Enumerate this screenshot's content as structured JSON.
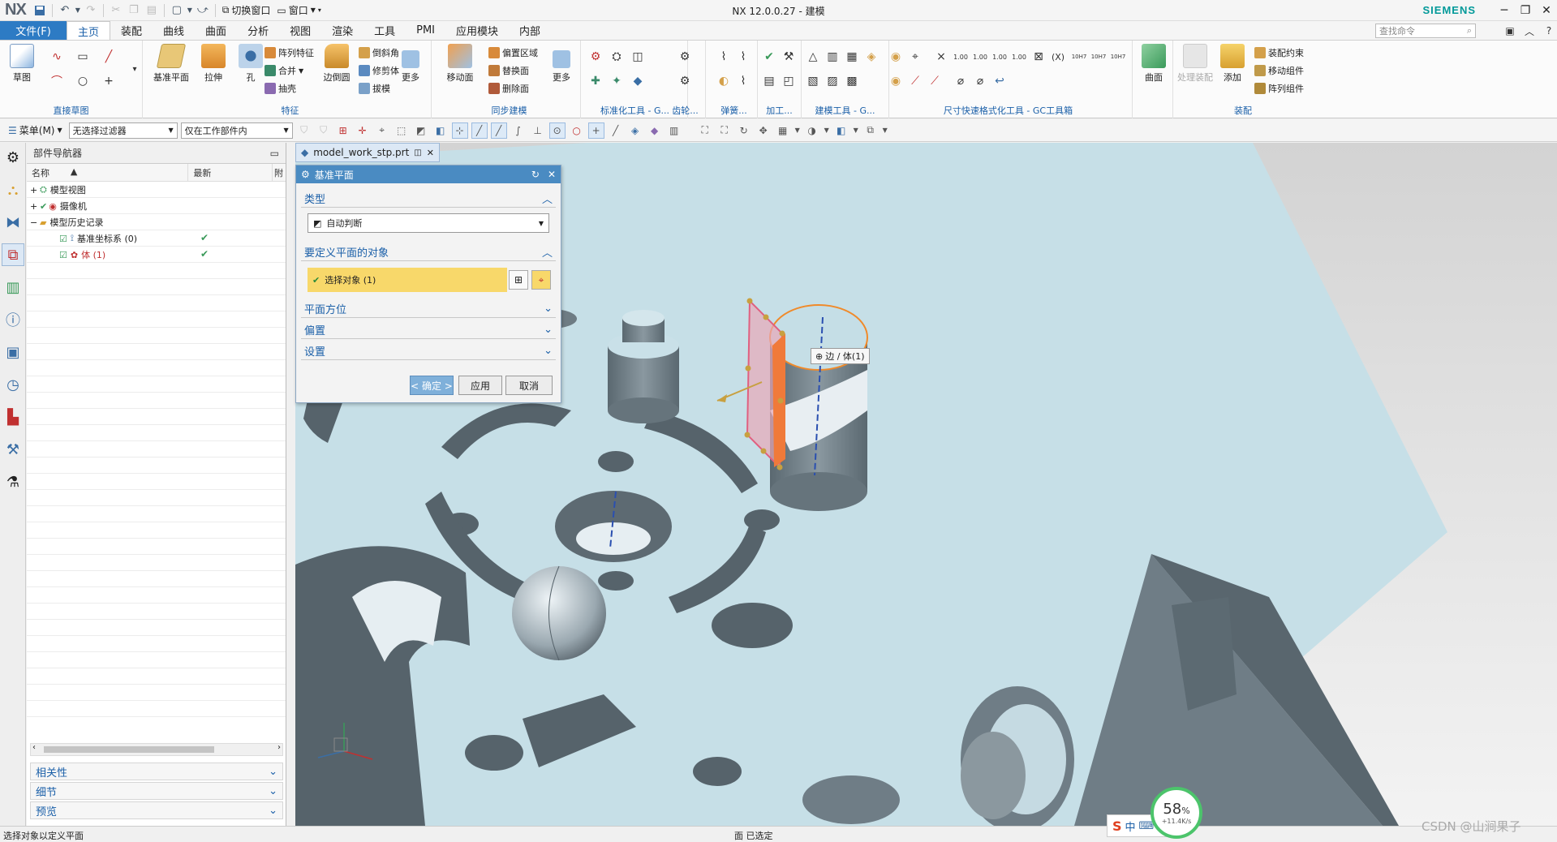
{
  "app": {
    "logo": "NX",
    "window_title": "NX 12.0.0.27 - 建模",
    "brand": "SIEMENS",
    "quick_access": {
      "switch_window": "切换窗口",
      "window": "窗口"
    }
  },
  "menu_tabs": {
    "file": "文件(F)",
    "items": [
      "主页",
      "装配",
      "曲线",
      "曲面",
      "分析",
      "视图",
      "渲染",
      "工具",
      "PMI",
      "应用模块",
      "内部"
    ],
    "active": "主页",
    "search_placeholder": "查找命令"
  },
  "ribbon": {
    "direct_sketch": {
      "label": "直接草图",
      "sketch": "草图"
    },
    "feature": {
      "label": "特征",
      "datum_plane": "基准平面",
      "extrude": "拉伸",
      "hole": "孔",
      "pattern": "阵列特征",
      "unite": "合并",
      "shell": "抽壳",
      "edge_blend": "边倒圆",
      "chamfer": "倒斜角",
      "trim_body": "修剪体",
      "draft": "拔模",
      "more": "更多"
    },
    "sync": {
      "label": "同步建模",
      "move_face": "移动面",
      "offset_region": "偏置区域",
      "replace": "替换面",
      "delete_face": "删除面",
      "more": "更多"
    },
    "std_tools": "标准化工具 - G...",
    "gear": "齿轮...",
    "spring": "弹簧...",
    "machining": "加工...",
    "model_tools": "建模工具 - G...",
    "dim_tools": "尺寸快速格式化工具 - GC工具箱",
    "surface": {
      "label": "曲面",
      "btn": "曲面"
    },
    "assembly": {
      "label": "装配",
      "process": "处理装配",
      "add": "添加",
      "constraint": "装配约束",
      "move_comp": "移动组件",
      "array_comp": "阵列组件"
    }
  },
  "selection_bar": {
    "menu": "菜单(M)",
    "filter": "无选择过滤器",
    "scope": "仅在工作部件内"
  },
  "navigator": {
    "title": "部件导航器",
    "col_name": "名称",
    "col_latest": "最新",
    "col_extra": "附",
    "tree": [
      {
        "label": "模型视图",
        "level": 0
      },
      {
        "label": "摄像机",
        "level": 0
      },
      {
        "label": "模型历史记录",
        "level": 0
      },
      {
        "label": "基准坐标系 (0)",
        "level": 1
      },
      {
        "label": "体 (1)",
        "level": 1
      }
    ],
    "sections": [
      "相关性",
      "细节",
      "预览"
    ]
  },
  "document": {
    "tab": "model_work_stp.prt"
  },
  "dialog": {
    "title": "基准平面",
    "type_label": "类型",
    "type_value": "自动判断",
    "object_label": "要定义平面的对象",
    "select_object": "选择对象 (1)",
    "orientation": "平面方位",
    "offset": "偏置",
    "settings": "设置",
    "ok": "< 确定 >",
    "apply": "应用",
    "cancel": "取消"
  },
  "viewport": {
    "tooltip": "边 / 体(1)",
    "colors": {
      "bg_top": "#d6d6d6",
      "bg_bottom": "#f2f2f2",
      "part": "#c9e2e9",
      "side": "#6f7d86"
    }
  },
  "status": {
    "prompt": "选择对象以定义平面",
    "selected": "面 已选定"
  },
  "overlay": {
    "perf_value": "58",
    "perf_unit": "%",
    "perf_speed": "+11.4K/s",
    "ime": "中",
    "watermark": "CSDN @山涧果子"
  }
}
